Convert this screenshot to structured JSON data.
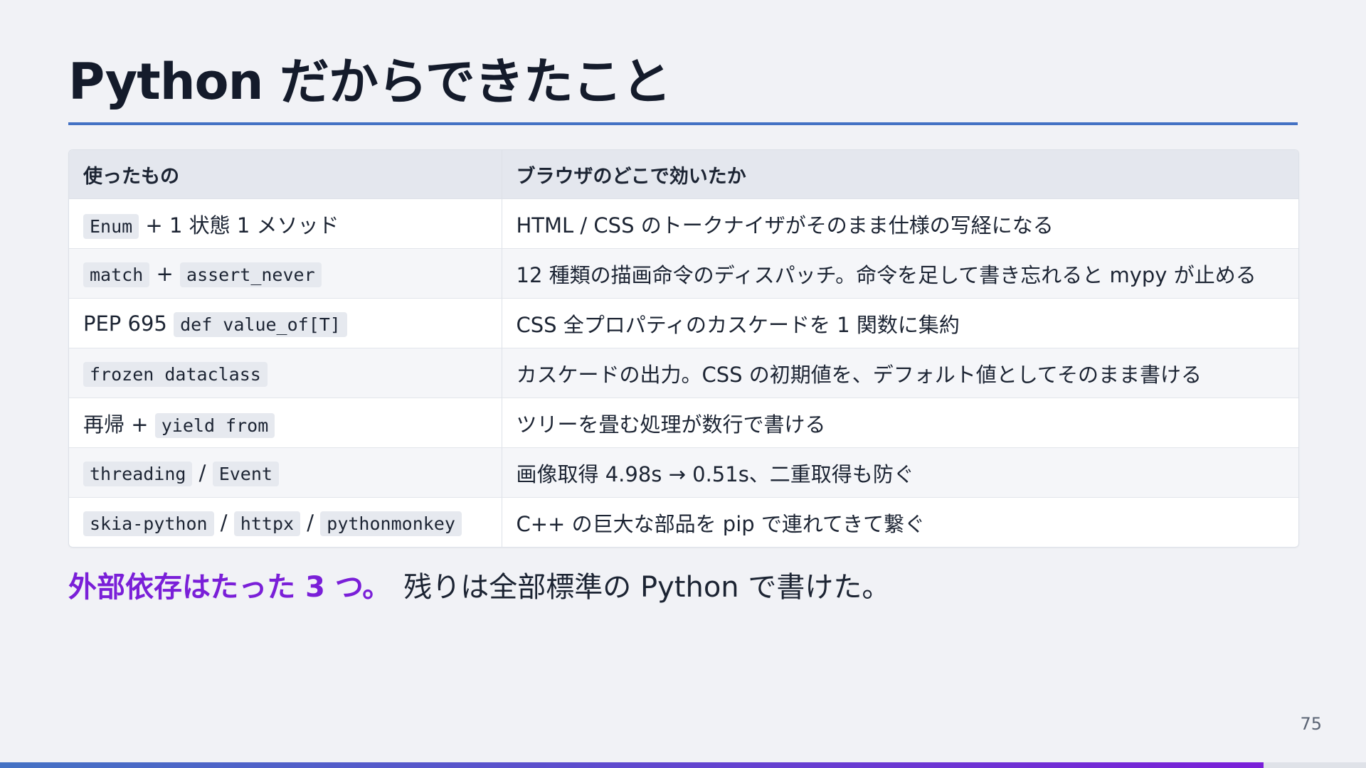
{
  "slide": {
    "title": "Python だからできたこと",
    "page_number": "75",
    "progress": 0.925
  },
  "table": {
    "headers": [
      "使ったもの",
      "ブラウザのどこで効いたか"
    ],
    "rows": [
      {
        "used": [
          {
            "kind": "code",
            "text": "Enum"
          },
          {
            "kind": "text",
            "text": " + 1 状態 1 メソッド"
          }
        ],
        "effect": "HTML / CSS のトークナイザがそのまま仕様の写経になる"
      },
      {
        "used": [
          {
            "kind": "code",
            "text": "match"
          },
          {
            "kind": "text",
            "text": " + "
          },
          {
            "kind": "code",
            "text": "assert_never"
          }
        ],
        "effect": "12 種類の描画命令のディスパッチ。命令を足して書き忘れると mypy が止める"
      },
      {
        "used": [
          {
            "kind": "text",
            "text": "PEP 695 "
          },
          {
            "kind": "code",
            "text": "def value_of[T]"
          }
        ],
        "effect": "CSS 全プロパティのカスケードを 1 関数に集約"
      },
      {
        "used": [
          {
            "kind": "code",
            "text": "frozen dataclass"
          }
        ],
        "effect": "カスケードの出力。CSS の初期値を、デフォルト値としてそのまま書ける"
      },
      {
        "used": [
          {
            "kind": "text",
            "text": "再帰 + "
          },
          {
            "kind": "code",
            "text": "yield from"
          }
        ],
        "effect": "ツリーを畳む処理が数行で書ける"
      },
      {
        "used": [
          {
            "kind": "code",
            "text": "threading"
          },
          {
            "kind": "text",
            "text": " / "
          },
          {
            "kind": "code",
            "text": "Event"
          }
        ],
        "effect": "画像取得 4.98s → 0.51s、二重取得も防ぐ"
      },
      {
        "used": [
          {
            "kind": "code",
            "text": "skia-python"
          },
          {
            "kind": "text",
            "text": " / "
          },
          {
            "kind": "code",
            "text": "httpx"
          },
          {
            "kind": "text",
            "text": " / "
          },
          {
            "kind": "code",
            "text": "pythonmonkey"
          }
        ],
        "effect": "C++ の巨大な部品を pip で連れてきて繋ぐ"
      }
    ]
  },
  "conclusion": {
    "highlight": "外部依存はたった 3 つ。",
    "rest": "残りは全部標準の Python で書けた。"
  },
  "colors": {
    "accent_blue": "#4472c4",
    "accent_purple": "#7a1fd8",
    "background": "#f1f2f6"
  }
}
